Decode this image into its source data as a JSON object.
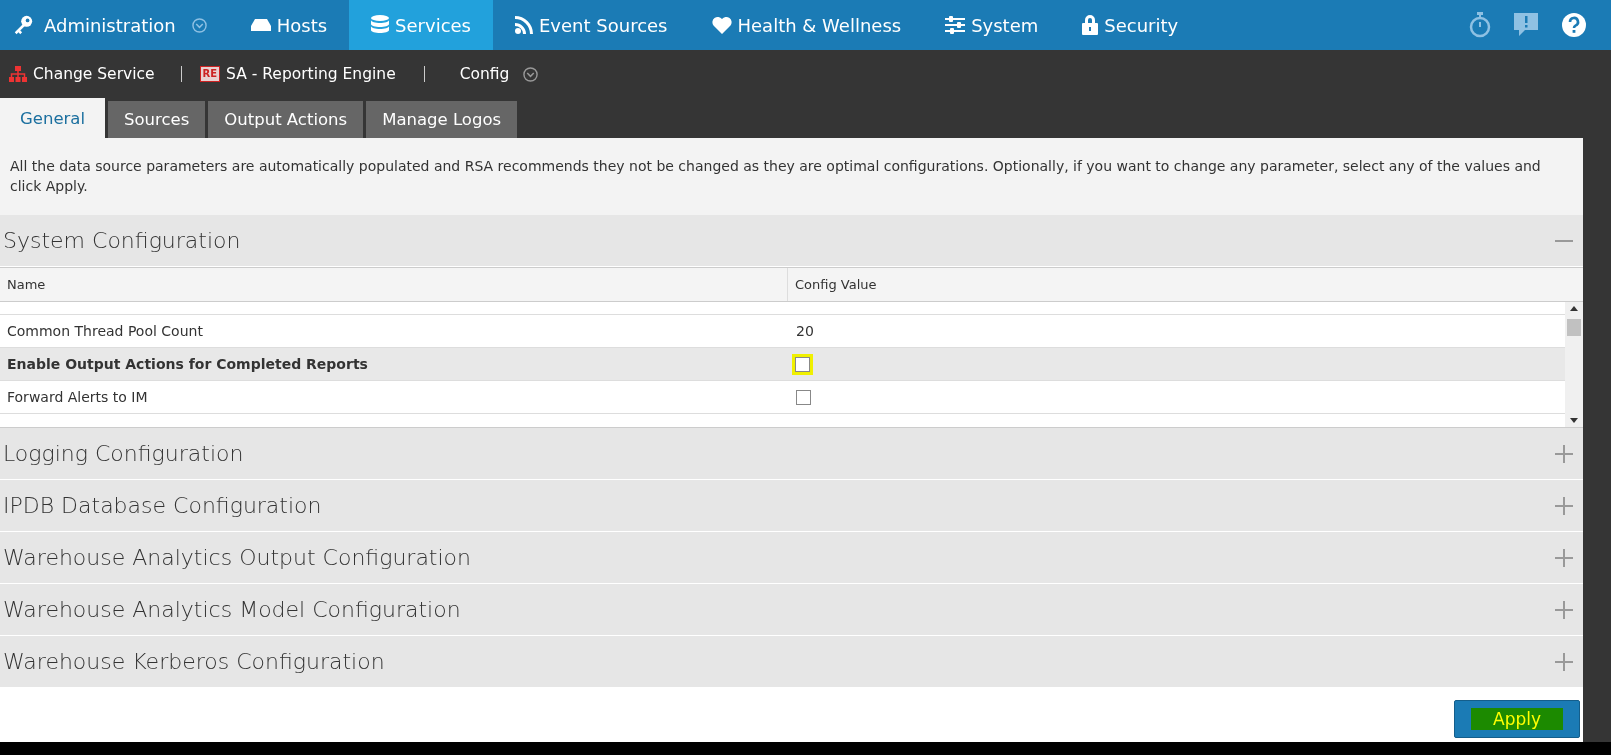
{
  "top_nav": {
    "items": [
      {
        "label": "Administration",
        "kind": "key",
        "selected": false,
        "dropdown": true
      },
      {
        "label": "Hosts",
        "kind": "hosts",
        "selected": false,
        "dropdown": false
      },
      {
        "label": "Services",
        "kind": "database",
        "selected": true,
        "dropdown": false
      },
      {
        "label": "Event Sources",
        "kind": "rss",
        "selected": false,
        "dropdown": false
      },
      {
        "label": "Health & Wellness",
        "kind": "heart",
        "selected": false,
        "dropdown": false
      },
      {
        "label": "System",
        "kind": "sliders",
        "selected": false,
        "dropdown": false
      },
      {
        "label": "Security",
        "kind": "lock",
        "selected": false,
        "dropdown": false
      }
    ]
  },
  "sub_bar": {
    "change_service": "Change Service",
    "service_badge": "RE",
    "service": "SA - Reporting Engine",
    "view": "Config"
  },
  "tabs": [
    {
      "label": "General",
      "selected": true
    },
    {
      "label": "Sources",
      "selected": false
    },
    {
      "label": "Output Actions",
      "selected": false
    },
    {
      "label": "Manage Logos",
      "selected": false
    }
  ],
  "description": "All the data source parameters are automatically populated and RSA recommends they not be changed as they are optimal configurations. Optionally, if you want to change any parameter, select any of the values and click Apply.",
  "sections": [
    {
      "title": "System Configuration",
      "expanded": true,
      "table": {
        "columns": [
          "Name",
          "Config Value"
        ],
        "rows": [
          {
            "name": "Common Thread Pool Count",
            "kind": "text",
            "value": "20",
            "selected": false
          },
          {
            "name": "Enable Output Actions for Completed Reports",
            "kind": "checkbox",
            "checked": false,
            "highlighted": true,
            "selected": true
          },
          {
            "name": "Forward Alerts to IM",
            "kind": "checkbox",
            "checked": false,
            "highlighted": false,
            "selected": false
          }
        ]
      }
    },
    {
      "title": "Logging Configuration",
      "expanded": false
    },
    {
      "title": "IPDB Database Configuration",
      "expanded": false
    },
    {
      "title": "Warehouse Analytics Output Configuration",
      "expanded": false
    },
    {
      "title": "Warehouse Analytics Model Configuration",
      "expanded": false
    },
    {
      "title": "Warehouse Kerberos Configuration",
      "expanded": false
    }
  ],
  "apply_button": {
    "label": "Apply",
    "highlighted": true
  }
}
